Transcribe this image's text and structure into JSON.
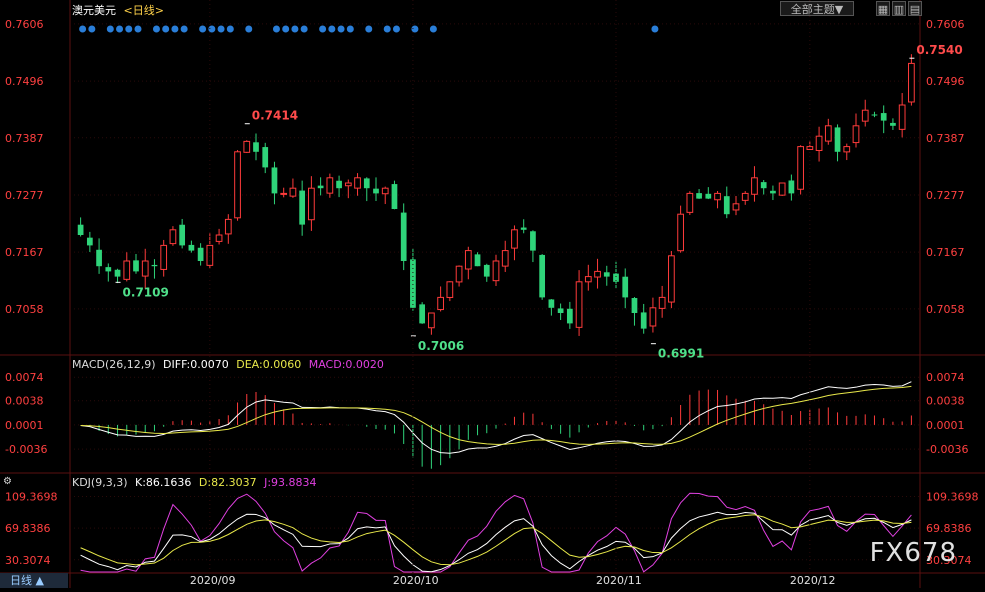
{
  "header": {
    "title": "澳元美元",
    "period": "<日线>",
    "theme_btn": "全部主题▼",
    "btn_icon1": "▦",
    "btn_icon2": "▥",
    "btn_icon3": "▤"
  },
  "macd": {
    "label": "MACD(26,12,9)",
    "diff": "DIFF:0.0070",
    "dea": "DEA:0.0060",
    "macd": "MACD:0.0020"
  },
  "kdj": {
    "label": "KDJ(9,3,3)",
    "k": "K:86.1636",
    "d": "D:82.3037",
    "j": "J:93.8834"
  },
  "footer": {
    "period_tab": "日线 ▲"
  },
  "watermark": "FX678",
  "colors": {
    "up": "#ff3b3b",
    "down": "#2fd47a",
    "axis": "#ff4040",
    "diff": "#ffffff",
    "dea": "#e8e84a",
    "macdLabel": "#e040e0",
    "kdjJ": "#e040e0",
    "dot": "#2a7ed8"
  },
  "chart_data": {
    "type": "candlestick",
    "price_axis_ticks": [
      "0.7606",
      "0.7496",
      "0.7387",
      "0.7277",
      "0.7167",
      "0.7058"
    ],
    "price_range": [
      0.6975,
      0.7625
    ],
    "macd_axis_ticks": [
      "0.0074",
      "0.0038",
      "0.0001",
      "-0.0036"
    ],
    "kdj_axis_ticks": [
      "109.3698",
      "69.8386",
      "30.3074"
    ],
    "x_labels": [
      {
        "label": "2020/09",
        "index": 14
      },
      {
        "label": "2020/10",
        "index": 36
      },
      {
        "label": "2020/11",
        "index": 58
      },
      {
        "label": "2020/12",
        "index": 79
      }
    ],
    "annotations": [
      {
        "text": "0.7414",
        "index": 18,
        "value": 0.7414
      },
      {
        "text": "0.7109",
        "index": 4,
        "value": 0.7109
      },
      {
        "text": "0.7006",
        "index": 36,
        "value": 0.7006
      },
      {
        "text": "0.6991",
        "index": 62,
        "value": 0.6991
      },
      {
        "text": "0.7540",
        "index": 90,
        "value": 0.754
      }
    ],
    "closes": [
      0.72,
      0.718,
      0.714,
      0.713,
      0.712,
      0.715,
      0.713,
      0.715,
      0.714,
      0.718,
      0.721,
      0.718,
      0.717,
      0.715,
      0.718,
      0.72,
      0.723,
      0.736,
      0.738,
      0.736,
      0.733,
      0.728,
      0.728,
      0.729,
      0.722,
      0.729,
      0.729,
      0.731,
      0.729,
      0.73,
      0.731,
      0.729,
      0.728,
      0.729,
      0.725,
      0.715,
      0.706,
      0.703,
      0.705,
      0.708,
      0.711,
      0.714,
      0.717,
      0.714,
      0.712,
      0.715,
      0.717,
      0.721,
      0.721,
      0.717,
      0.708,
      0.706,
      0.705,
      0.703,
      0.711,
      0.712,
      0.713,
      0.712,
      0.711,
      0.708,
      0.705,
      0.702,
      0.706,
      0.708,
      0.716,
      0.724,
      0.728,
      0.727,
      0.727,
      0.728,
      0.724,
      0.726,
      0.728,
      0.731,
      0.729,
      0.728,
      0.73,
      0.728,
      0.737,
      0.737,
      0.739,
      0.741,
      0.736,
      0.737,
      0.741,
      0.744,
      0.743,
      0.742,
      0.741,
      0.745,
      0.753
    ]
  }
}
